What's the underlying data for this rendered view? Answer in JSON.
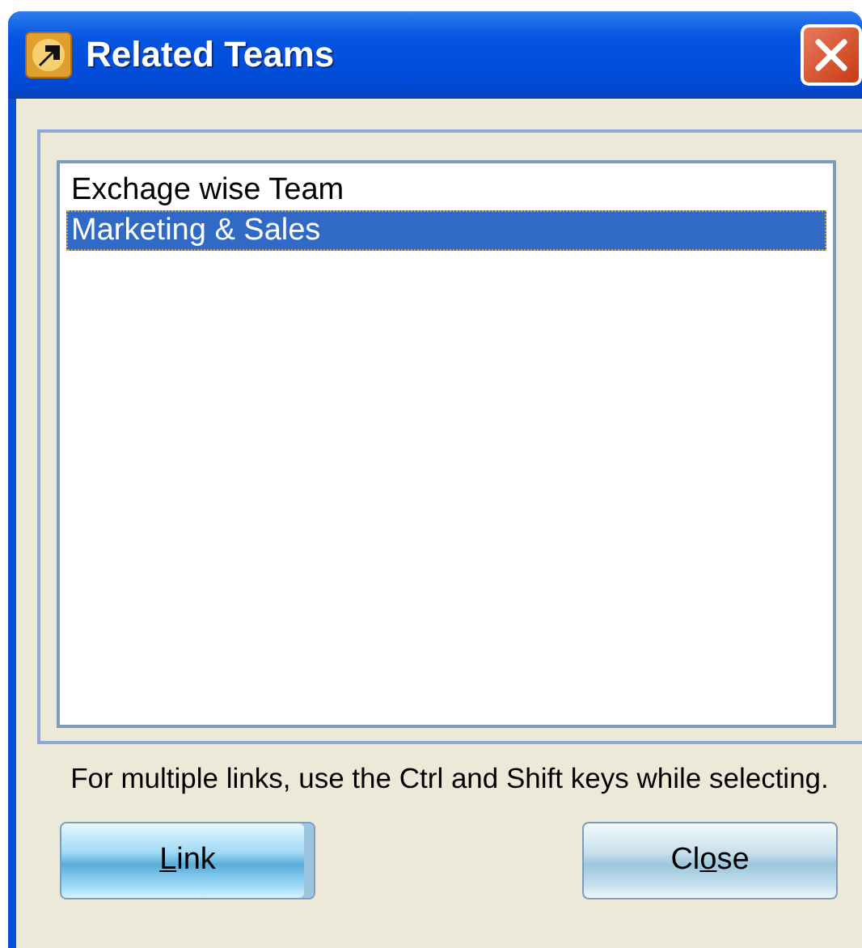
{
  "window": {
    "title": "Related Teams"
  },
  "list": {
    "items": [
      {
        "label": "Exchage wise Team",
        "selected": false
      },
      {
        "label": "Marketing & Sales",
        "selected": true
      }
    ]
  },
  "hint": "For multiple links, use the Ctrl and Shift keys while selecting.",
  "buttons": [
    {
      "kind": "default",
      "key": "L",
      "after": "ink"
    },
    {
      "kind": "normal",
      "before": "Cl",
      "key": "o",
      "after": "se"
    }
  ]
}
